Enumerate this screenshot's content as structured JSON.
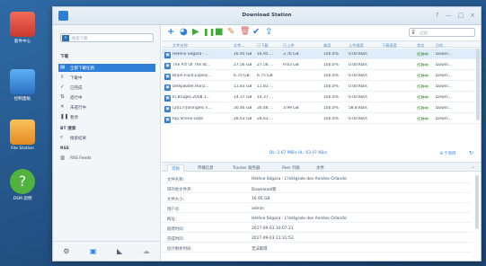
{
  "desktop": {
    "icons": [
      {
        "label": "套件中心",
        "icon": "package-center-icon",
        "color": "#e2483d"
      },
      {
        "label": "控制面板",
        "icon": "control-panel-icon",
        "color": "#3d8fe0"
      },
      {
        "label": "File Station",
        "icon": "file-station-icon",
        "color": "#f2a13a"
      },
      {
        "label": "DSM 說明",
        "icon": "help-icon",
        "color": "#4fb33c"
      }
    ]
  },
  "window": {
    "title": "Download Station",
    "controls": [
      "?",
      "—",
      "□",
      "×"
    ]
  },
  "sidebar": {
    "search_placeholder": "搜索下載",
    "download_header": "下载",
    "items": [
      {
        "label": "全部下載任務",
        "icon": "all-tasks-icon",
        "glyph": "▤"
      },
      {
        "label": "下載中",
        "icon": "downloading-icon",
        "glyph": "⇩"
      },
      {
        "label": "已完成",
        "icon": "completed-icon",
        "glyph": "✓"
      },
      {
        "label": "進行中",
        "icon": "active-icon",
        "glyph": "⇅"
      },
      {
        "label": "未進行中",
        "icon": "inactive-icon",
        "glyph": "✕"
      },
      {
        "label": "暫停",
        "icon": "paused-icon",
        "glyph": "❚❚"
      }
    ],
    "bt_header": "BT 搜索",
    "bt_items": [
      {
        "label": "搜索結果",
        "icon": "search-results-icon",
        "glyph": "⌕"
      }
    ],
    "rss_header": "RSS",
    "rss_items": [
      {
        "label": "RSS Feeds",
        "icon": "rss-feeds-icon",
        "glyph": "▥"
      }
    ],
    "footer_icons": [
      {
        "icon": "settings-icon",
        "glyph": "⚙"
      },
      {
        "icon": "bt-icon",
        "glyph": "▣"
      },
      {
        "icon": "emule-icon",
        "glyph": "◣"
      },
      {
        "icon": "cloud-icon",
        "glyph": "☁"
      }
    ]
  },
  "toolbar": {
    "buttons": [
      {
        "icon": "add-icon",
        "glyph": "+",
        "color": "#2f7ed8"
      },
      {
        "icon": "add-url-icon",
        "glyph": "◕",
        "color": "#2f7ed8"
      },
      {
        "icon": "resume-icon",
        "glyph": "▶",
        "color": "#43a83a"
      },
      {
        "icon": "pause-icon",
        "glyph": "❚❚",
        "color": "#43a83a"
      },
      {
        "icon": "stop-icon",
        "glyph": "■",
        "color": "#43a83a"
      },
      {
        "icon": "edit-icon",
        "glyph": "✎",
        "color": "#e1863c"
      },
      {
        "icon": "delete-icon",
        "glyph": "🗑",
        "color": "#d9534f"
      },
      {
        "icon": "clear-completed-icon",
        "glyph": "✔",
        "color": "#2f7ed8"
      },
      {
        "icon": "share-icon",
        "glyph": "⇪",
        "color": "#2f7ed8"
      }
    ],
    "filter_placeholder": "过滤"
  },
  "grid": {
    "columns": [
      "文件名称",
      "文件...",
      "已下載",
      "已上传",
      "進度",
      "上传速度",
      "下载速度",
      "状态",
      "目的..."
    ],
    "rows": [
      [
        "Hélène Ségara - ...",
        "16.95 GB",
        "16.95 ...",
        "3.76 GB",
        "100.0%",
        "0.00 KB/s",
        "",
        "作种中",
        "Downl..."
      ],
      [
        "The Art Of The St...",
        "27.56 GB",
        "27.56 ...",
        "9.63 GB",
        "100.0%",
        "0.00 KB/s",
        "",
        "作种中",
        "Downl..."
      ],
      [
        "Brain.Fluid.Explos...",
        "6.75 GB",
        "6.75 GB",
        "",
        "100.0%",
        "0.00 KB/s",
        "",
        "作种中",
        "Downl..."
      ],
      [
        "Deepwater.Horiz...",
        "11.83 GB",
        "11.83 ...",
        "",
        "100.0%",
        "0.00 KB/s",
        "",
        "作种中",
        "Downl..."
      ],
      [
        "In.Bruges.2008.1...",
        "14.37 GB",
        "14.37 ...",
        "",
        "100.0%",
        "0.00 KB/s",
        "",
        "作种中",
        "Downl..."
      ],
      [
        "[2017][Shingeki n...",
        "30.46 GB",
        "30.46 ...",
        "3.99 GB",
        "100.0%",
        "58.8 KB/s",
        "",
        "作种中",
        "Downl..."
      ],
      [
        "Rip.Sheno.Gate",
        "28.63 GB",
        "28.63 ...",
        "",
        "100.0%",
        "0.00 KB/s",
        "",
        "作种中",
        "Downl..."
      ]
    ],
    "footer_speed": "DL: 2.67 MB/s UL: 63.07 KB/s",
    "footer_count": "8 个项目",
    "refresh_glyph": "↻"
  },
  "detail_tabs": [
    "常规",
    "传输信息",
    "Tracker 服务器",
    "Peer 列表",
    "文件"
  ],
  "detail_collapse_glyph": "⌄",
  "details": [
    {
      "key": "文件名称:",
      "value": "Hélène Ségara - L'Intégrale des Années Orlando"
    },
    {
      "key": "目的地文件夹:",
      "value": "Download/新"
    },
    {
      "key": "文件大小:",
      "value": "16.95 GB"
    },
    {
      "key": "用户名:",
      "value": "admin"
    },
    {
      "key": "网址:",
      "value": "Hélène Ségara - L'Intégrale des Années Orlando"
    },
    {
      "key": "創建时间:",
      "value": "2017-09-03 10:07:21"
    },
    {
      "key": "完成时间:",
      "value": "2017-09-03 11:31:52"
    },
    {
      "key": "估计剩余时间:",
      "value": "无法取得"
    }
  ]
}
